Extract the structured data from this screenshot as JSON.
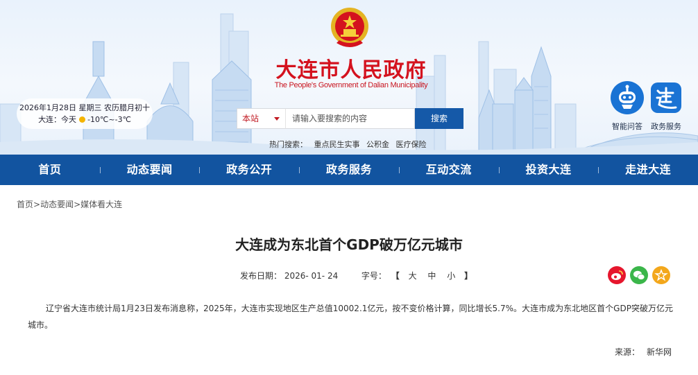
{
  "header": {
    "title": "大连市人民政府",
    "subtitle": "The People's Government of Dalian Municipality",
    "date_line": "2026年1月28日 星期三 农历腊月初十",
    "weather_city": "大连：今天",
    "weather_temp": "-10℃~-3℃",
    "search": {
      "scope": "本站",
      "placeholder": "请输入要搜索的内容",
      "button": "搜索"
    },
    "hot": {
      "label": "热门搜索：",
      "items": [
        "重点民生实事",
        "公积金",
        "医疗保险"
      ]
    },
    "quick_links": [
      {
        "label": "智能问答",
        "icon": "robot-icon"
      },
      {
        "label": "政务服务",
        "icon": "service-icon"
      }
    ]
  },
  "nav": [
    "首页",
    "动态要闻",
    "政务公开",
    "政务服务",
    "互动交流",
    "投资大连",
    "走进大连"
  ],
  "breadcrumb": [
    "首页",
    "动态要闻",
    "媒体看大连"
  ],
  "article": {
    "title": "大连成为东北首个GDP破万亿元城市",
    "date_label": "发布日期：",
    "date": "2026- 01- 24",
    "font_label": "字号：",
    "font_sizes": [
      "大",
      "中",
      "小"
    ],
    "body": "辽宁省大连市统计局1月23日发布消息称，2025年，大连市实现地区生产总值10002.1亿元，按不变价格计算，同比增长5.7%。大连市成为东北地区首个GDP突破万亿元城市。",
    "source_label": "来源：",
    "source": "新华网"
  },
  "share": [
    "weibo-icon",
    "wechat-icon",
    "favorite-icon"
  ],
  "colors": {
    "nav_bg": "#1254a0",
    "title_red": "#d4121e",
    "search_btn": "#1559a8"
  }
}
